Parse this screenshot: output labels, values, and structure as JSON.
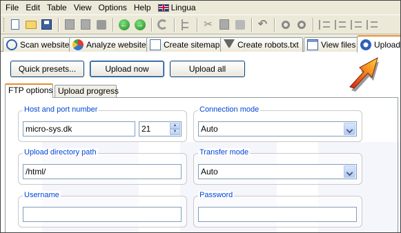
{
  "menubar": {
    "items": [
      "File",
      "Edit",
      "Table",
      "View",
      "Options",
      "Help"
    ],
    "lingua": "Lingua"
  },
  "tabs": [
    {
      "label": "Scan website",
      "icon": "scan-icon"
    },
    {
      "label": "Analyze website",
      "icon": "analyze-icon"
    },
    {
      "label": "Create sitemap",
      "icon": "sitemap-icon"
    },
    {
      "label": "Create robots.txt",
      "icon": "robots-icon"
    },
    {
      "label": "View files",
      "icon": "view-files-icon"
    },
    {
      "label": "Upload",
      "icon": "upload-icon",
      "active": true
    }
  ],
  "actions": {
    "quick_presets": "Quick presets...",
    "upload_now": "Upload now",
    "upload_all": "Upload all"
  },
  "subtabs": {
    "ftp_options": "FTP options",
    "upload_progress": "Upload progress"
  },
  "ftp": {
    "host_label": "Host and port number",
    "host_value": "micro-sys.dk",
    "port_value": "21",
    "connection_mode_label": "Connection mode",
    "connection_mode_value": "Auto",
    "upload_dir_label": "Upload directory path",
    "upload_dir_value": "/html/",
    "transfer_mode_label": "Transfer mode",
    "transfer_mode_value": "Auto",
    "username_label": "Username",
    "username_value": "",
    "password_label": "Password",
    "password_value": ""
  },
  "colors": {
    "chrome": "#ece9d8",
    "group_label": "#0046d5",
    "active_tab_accent": "#e68b2c",
    "button_border": "#003c74"
  }
}
